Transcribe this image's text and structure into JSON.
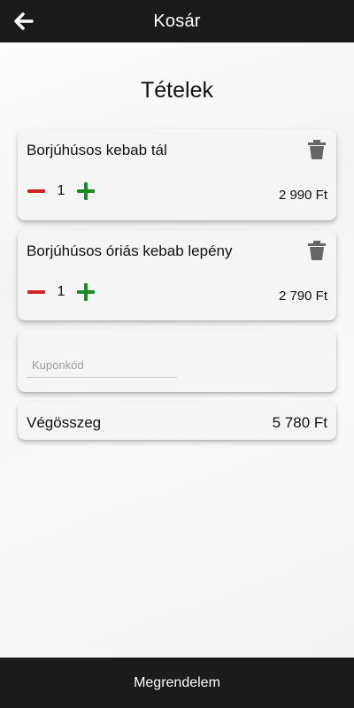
{
  "header": {
    "title": "Kosár",
    "back_icon": "arrow-left-icon"
  },
  "section_title": "Tételek",
  "items": [
    {
      "name": "Borjúhúsos kebab tál",
      "quantity": "1",
      "price": "2 990 Ft"
    },
    {
      "name": "Borjúhúsos óriás kebab lepény",
      "quantity": "1",
      "price": "2 790 Ft"
    }
  ],
  "coupon": {
    "placeholder": "Kuponkód",
    "value": ""
  },
  "total": {
    "label": "Végösszeg",
    "value": "5 780 Ft"
  },
  "footer": {
    "order_label": "Megrendelem"
  },
  "colors": {
    "bar": "#1b1b1b",
    "minus": "#d42323",
    "plus": "#1d8a28",
    "trash": "#666666"
  }
}
